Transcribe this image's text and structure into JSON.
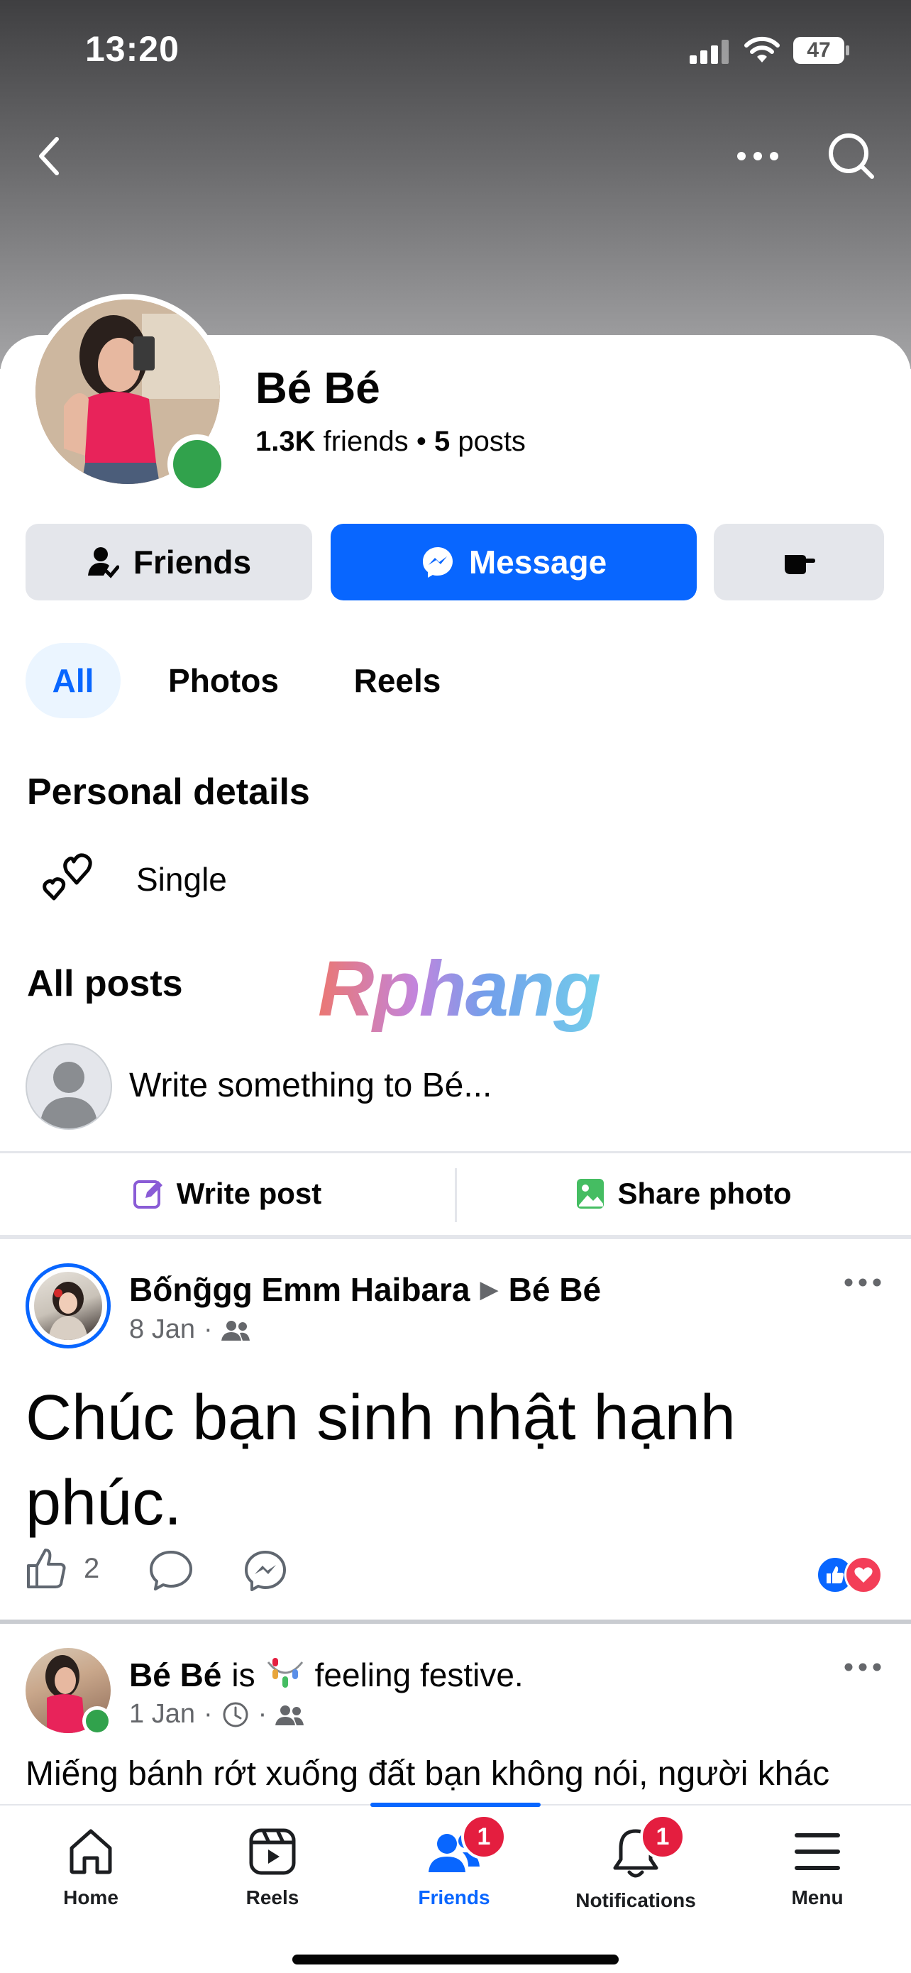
{
  "status_bar": {
    "time": "13:20",
    "battery": "47"
  },
  "profile": {
    "name": "Bé Bé",
    "friends_count": "1.3K",
    "friends_label": "friends",
    "separator": "•",
    "posts_count": "5",
    "posts_label": "posts"
  },
  "actions": {
    "friends_label": "Friends",
    "message_label": "Message"
  },
  "tabs": [
    {
      "label": "All"
    },
    {
      "label": "Photos"
    },
    {
      "label": "Reels"
    }
  ],
  "personal_details": {
    "title": "Personal details",
    "relationship": "Single"
  },
  "all_posts": {
    "title": "All posts"
  },
  "watermark": "Rphang",
  "composer": {
    "placeholder": "Write something to Bé...",
    "write_post": "Write post",
    "share_photo": "Share photo"
  },
  "posts": [
    {
      "author": "Bống̃gg Emm Haibara",
      "arrow": "▶",
      "target": "Bé Bé",
      "date": "8 Jan",
      "text": "Chúc bạn sinh nhật hạnh phúc.",
      "like_count": "2"
    },
    {
      "author": "Bé Bé",
      "feeling_prefix": "is",
      "feeling": "feeling festive.",
      "date": "1 Jan",
      "text": "Miếng bánh rớt xuống đất bạn không nói, người khác"
    }
  ],
  "bottom_nav": [
    {
      "label": "Home",
      "icon": "home-icon"
    },
    {
      "label": "Reels",
      "icon": "reels-icon"
    },
    {
      "label": "Friends",
      "icon": "friends-icon",
      "badge": "1",
      "active": true
    },
    {
      "label": "Notifications",
      "icon": "bell-icon",
      "badge": "1"
    },
    {
      "label": "Menu",
      "icon": "menu-icon"
    }
  ],
  "colors": {
    "accent": "#0866ff",
    "online": "#31a24c",
    "badge": "#e41e3f"
  }
}
